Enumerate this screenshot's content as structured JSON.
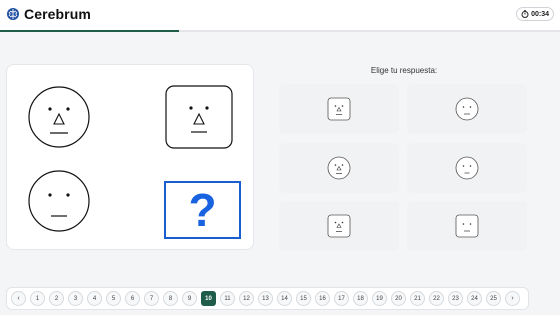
{
  "app": {
    "name": "Cerebrum",
    "timer": "00:34",
    "progress": 0.32
  },
  "answers": {
    "title": "Elige tu respuesta:"
  },
  "question_mark": "?",
  "pagination": {
    "prev": "‹",
    "next": "›",
    "pages": [
      "1",
      "2",
      "3",
      "4",
      "5",
      "6",
      "7",
      "8",
      "9",
      "10",
      "11",
      "12",
      "13",
      "14",
      "15",
      "16",
      "17",
      "18",
      "19",
      "20",
      "21",
      "22",
      "23",
      "24",
      "25"
    ],
    "current": "10"
  },
  "colors": {
    "accent": "#1f5d4a",
    "question": "#1a63e0"
  }
}
